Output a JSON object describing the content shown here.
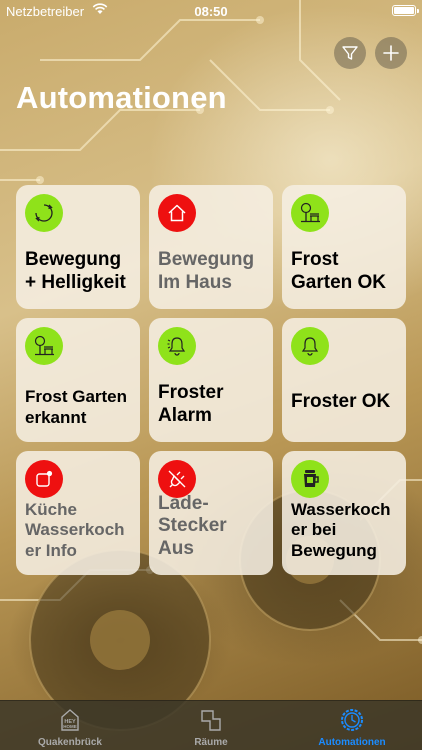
{
  "status_bar": {
    "carrier": "Netzbetreiber",
    "time": "08:50"
  },
  "header": {
    "title": "Automationen",
    "filter_icon": "funnel-icon",
    "add_icon": "plus-icon"
  },
  "tiles": [
    {
      "label": "Bewegung + Helligkeit",
      "icon": "cycle-arrows-icon",
      "icon_color": "#8fe21a",
      "dim": false
    },
    {
      "label": "Bewegung Im Haus",
      "icon": "house-icon",
      "icon_color": "#ee1010",
      "dim": true
    },
    {
      "label": "Frost Garten OK",
      "icon": "tree-bench-icon",
      "icon_color": "#8fe21a",
      "dim": false
    },
    {
      "label": "Frost Garten erkannt",
      "icon": "tree-bench-icon",
      "icon_color": "#8fe21a",
      "dim": false
    },
    {
      "label": "Froster Alarm",
      "icon": "bell-ringing-icon",
      "icon_color": "#8fe21a",
      "dim": false
    },
    {
      "label": "Froster OK",
      "icon": "bell-icon",
      "icon_color": "#8fe21a",
      "dim": false
    },
    {
      "label": "Küche Wasserkoch er Info",
      "icon": "notification-square-icon",
      "icon_color": "#ee1010",
      "dim": true
    },
    {
      "label": "Lade- Stecker Aus",
      "icon": "unplug-icon",
      "icon_color": "#ee1010",
      "dim": true
    },
    {
      "label": "Wasserkoch er bei Bewegung",
      "icon": "kettle-icon",
      "icon_color": "#8fe21a",
      "dim": false
    }
  ],
  "tile_lines": [
    [
      "Bewegung",
      "+ Helligkeit"
    ],
    [
      "Bewegung",
      "Im Haus"
    ],
    [
      "Frost",
      "Garten OK"
    ],
    [
      "Frost Garten",
      "erkannt"
    ],
    [
      "Froster",
      "Alarm"
    ],
    [
      "Froster OK"
    ],
    [
      "Küche",
      "Wasserkoch",
      "er Info"
    ],
    [
      "Lade-",
      "Stecker Aus"
    ],
    [
      "Wasserkoch",
      "er bei",
      "Bewegung"
    ]
  ],
  "tab_bar": {
    "tabs": [
      {
        "label": "Quakenbrück",
        "icon": "hey-home-icon",
        "active": false
      },
      {
        "label": "Räume",
        "icon": "rooms-icon",
        "active": false
      },
      {
        "label": "Automationen",
        "icon": "gear-clock-icon",
        "active": true
      }
    ]
  },
  "colors": {
    "accent": "#1b8cff",
    "status_green": "#8fe21a",
    "status_red": "#ee1010"
  }
}
